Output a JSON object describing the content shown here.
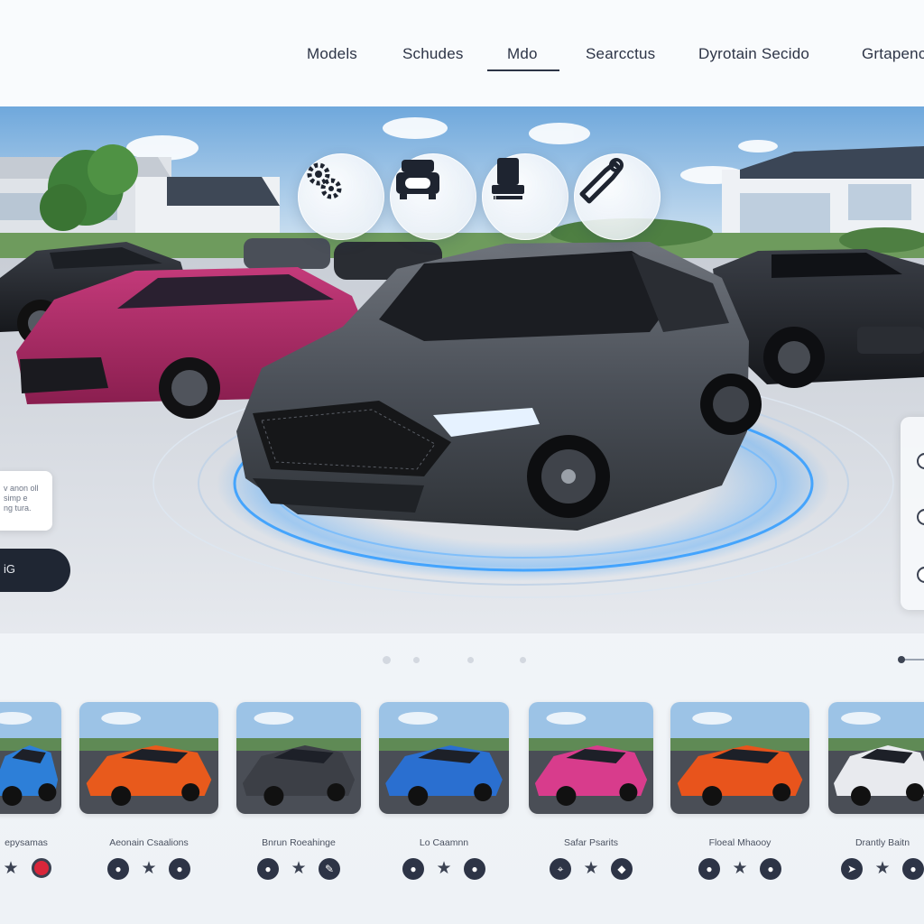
{
  "nav": {
    "items": [
      {
        "label": "Models"
      },
      {
        "label": "Schudes"
      },
      {
        "label": "Mdo"
      },
      {
        "label": "Searcctus"
      },
      {
        "label": "Dyrotain Secido"
      },
      {
        "label": "Grtapenc"
      }
    ],
    "active_index": 2
  },
  "hero": {
    "feature_icons": [
      "gears-icon",
      "seat-icon",
      "engine-icon",
      "wrench-icon"
    ],
    "info_card_text": "v anon oll\nsimp e\nng tura.",
    "cta_label": "iG",
    "side_toggles": 3
  },
  "carousel": {
    "dots": 4,
    "active_dot": 0
  },
  "cards": [
    {
      "title": "epysamas",
      "car_color": "#2d7fd8",
      "icons": [
        "star-icon",
        "red-circle-icon"
      ]
    },
    {
      "title": "Aeonain Csaalions",
      "car_color": "#e85a1c",
      "icons": [
        "circle-icon",
        "star-icon",
        "circle-icon"
      ]
    },
    {
      "title": "Bnrun Roeahinge",
      "car_color": "#3c3f46",
      "icons": [
        "circle-icon",
        "star-icon",
        "pen-icon"
      ]
    },
    {
      "title": "Lo Caamnn",
      "car_color": "#2a6fd0",
      "icons": [
        "circle-icon",
        "star-icon",
        "circle-icon"
      ]
    },
    {
      "title": "Safar Psarits",
      "car_color": "#d83c8c",
      "icons": [
        "pin-icon",
        "star-icon",
        "tag-icon"
      ]
    },
    {
      "title": "Floeal Mhaooy",
      "car_color": "#e8541c",
      "icons": [
        "circle-icon",
        "star-icon",
        "circle-icon"
      ]
    },
    {
      "title": "Drantly Baitn",
      "car_color": "#e8eaee",
      "icons": [
        "arrow-icon",
        "star-icon",
        "circle-icon"
      ]
    }
  ],
  "colors": {
    "accent": "#2f9bff",
    "nav_text": "#2d3446",
    "dark_button": "#1f2633"
  }
}
